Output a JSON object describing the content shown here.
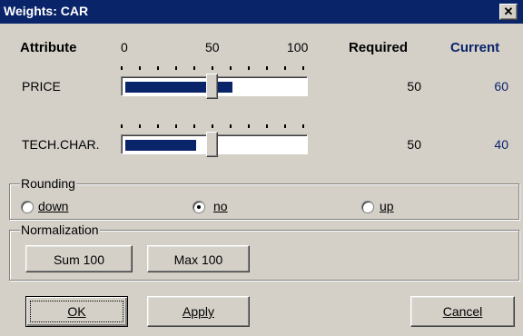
{
  "window": {
    "title": "Weights: CAR",
    "close_glyph": "✕"
  },
  "header": {
    "attribute": "Attribute",
    "required": "Required",
    "current": "Current"
  },
  "scale": {
    "min": "0",
    "mid": "50",
    "max": "100"
  },
  "attributes": [
    {
      "name": "PRICE",
      "required": "50",
      "current": "60",
      "required_value": 50,
      "current_value": 60
    },
    {
      "name": "TECH.CHAR.",
      "required": "50",
      "current": "40",
      "required_value": 50,
      "current_value": 40
    }
  ],
  "rounding": {
    "title": "Rounding",
    "options": [
      {
        "label": "down",
        "selected": false
      },
      {
        "label": "no",
        "selected": true
      },
      {
        "label": "up",
        "selected": false
      }
    ]
  },
  "normalization": {
    "title": "Normalization",
    "sum_label": "Sum 100",
    "max_label": "Max 100"
  },
  "buttons": {
    "ok": "OK",
    "apply": "Apply",
    "cancel": "Cancel"
  },
  "colors": {
    "title_bar": "#0a246a",
    "bar_fill": "#0a246a",
    "current_text": "#0a246a",
    "dialog_bg": "#d4d0c8"
  }
}
